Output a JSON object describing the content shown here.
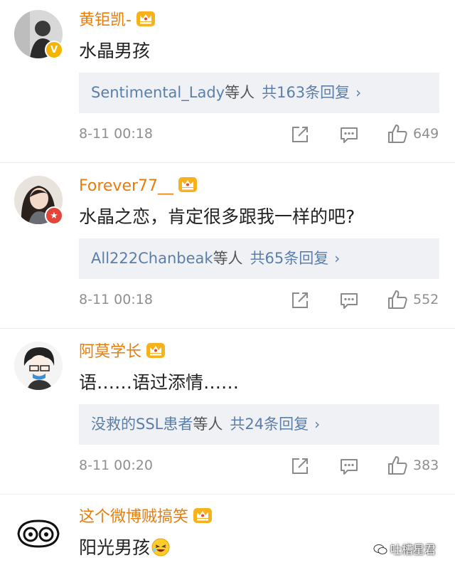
{
  "comments": [
    {
      "username": "黄钜凯-",
      "text": "水晶男孩",
      "reply_names": "Sentimental_Lady",
      "reply_suffix": "等人",
      "reply_count": "共163条回复",
      "time": "8-11 00:18",
      "likes": "649",
      "badge": "V"
    },
    {
      "username": "Forever77__",
      "text": "水晶之恋，肯定很多跟我一样的吧?",
      "reply_names": "All222Chanbeak",
      "reply_suffix": "等人",
      "reply_count": "共65条回复",
      "time": "8-11 00:18",
      "likes": "552",
      "badge": "★"
    },
    {
      "username": "阿莫学长",
      "text": "语……语过添情……",
      "reply_names": "没救的SSL患者",
      "reply_suffix": "等人",
      "reply_count": "共24条回复",
      "time": "8-11 00:20",
      "likes": "383"
    },
    {
      "username": "这个微博贼搞笑",
      "text": "阳光男孩"
    }
  ],
  "watermark": "吐槽星君",
  "icons": {
    "crown": "crown-icon",
    "share": "share-icon",
    "reply": "comment-icon",
    "like": "thumbs-up-icon",
    "emoji": "laughing-emoji-icon"
  },
  "colors": {
    "username": "#e87d0a",
    "link": "#5b7fa8",
    "reply_bg": "#eff1f4",
    "meta": "#8f8f8f"
  }
}
